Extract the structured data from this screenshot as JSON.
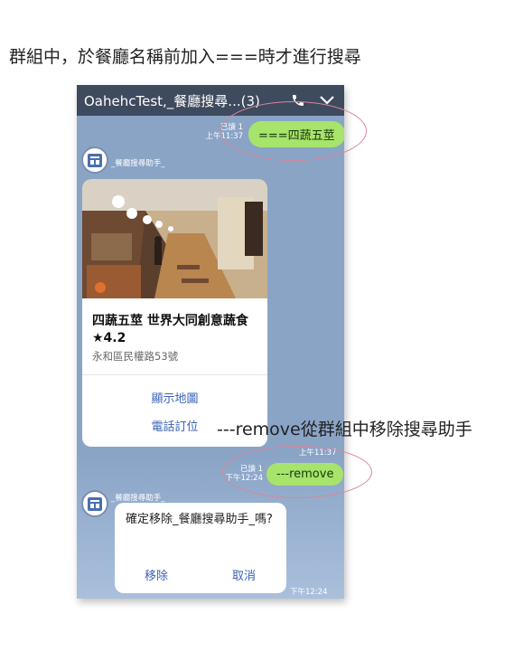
{
  "captions": {
    "top": "群組中，於餐廳名稱前加入===時才進行搜尋",
    "side": "---remove從群組中移除搜尋助手"
  },
  "header": {
    "title": "OahehcTest,_餐廳搜尋...(3)"
  },
  "messages": {
    "search": {
      "text": "===四蔬五莖",
      "read": "已讀 1",
      "time": "上午11:37"
    },
    "bot_name": "_餐廳搜尋助手_",
    "card": {
      "title": "四蔬五莖 世界大同創意蔬食★4.2",
      "address": "永和區民權路53號",
      "action_map": "顯示地圖",
      "action_call": "電話訂位",
      "time": "上午11:37"
    },
    "remove": {
      "text": "---remove",
      "read": "已讀 1",
      "time": "下午12:24"
    },
    "bot_name_2": "_餐廳搜尋助手_",
    "dialog": {
      "text": "確定移除_餐廳搜尋助手_嗎?",
      "confirm": "移除",
      "cancel": "取消",
      "time": "下午12:24"
    }
  },
  "colors": {
    "chat_bg": "#8aa4c6",
    "header_bg": "#3e4a5e",
    "bubble": "#a6e46b",
    "link": "#3a62b8",
    "highlight": "#d9869a"
  },
  "icons": [
    "phone-icon",
    "chevron-down-icon",
    "bot-avatar-icon"
  ]
}
